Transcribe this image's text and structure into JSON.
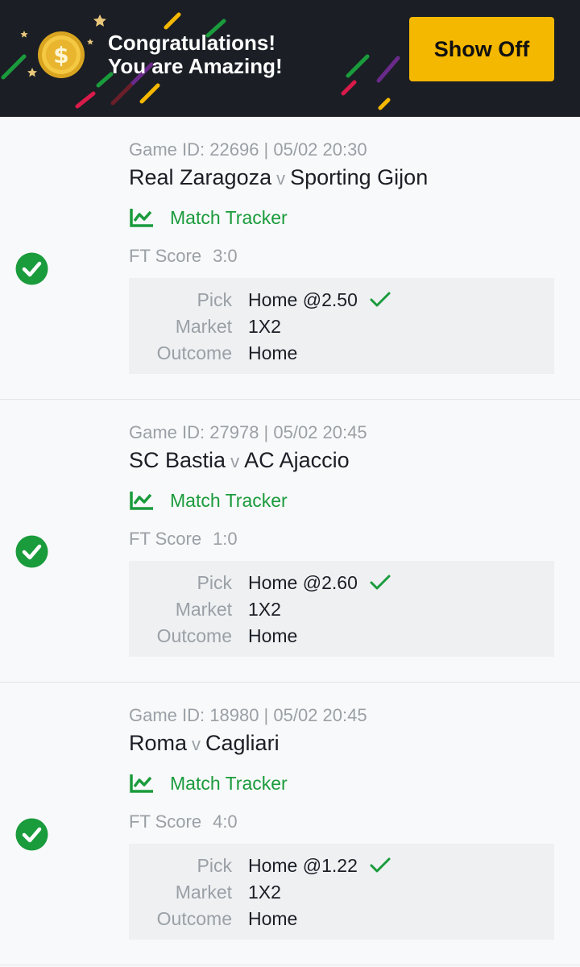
{
  "banner": {
    "line1": "Congratulations!",
    "line2": "You are Amazing!",
    "show_off_label": "Show Off",
    "coin_icon": "dollar-coin-icon",
    "colors": {
      "background": "#1b1e25",
      "button": "#f5b800"
    }
  },
  "colors": {
    "win_green": "#1a9b3c",
    "muted": "#9aa0a6",
    "text": "#1b1e25"
  },
  "bets": [
    {
      "game_meta": "Game ID: 22696 | 05/02 20:30",
      "home": "Real Zaragoza",
      "vs": "v",
      "away": "Sporting Gijon",
      "tracker_label": "Match Tracker",
      "ft_label": "FT Score",
      "ft_score": "3:0",
      "pick_label": "Pick",
      "pick": "Home @2.50",
      "market_label": "Market",
      "market": "1X2",
      "outcome_label": "Outcome",
      "outcome": "Home"
    },
    {
      "game_meta": "Game ID: 27978 | 05/02 20:45",
      "home": "SC Bastia",
      "vs": "v",
      "away": "AC Ajaccio",
      "tracker_label": "Match Tracker",
      "ft_label": "FT Score",
      "ft_score": "1:0",
      "pick_label": "Pick",
      "pick": "Home @2.60",
      "market_label": "Market",
      "market": "1X2",
      "outcome_label": "Outcome",
      "outcome": "Home"
    },
    {
      "game_meta": "Game ID: 18980 | 05/02 20:45",
      "home": "Roma",
      "vs": "v",
      "away": "Cagliari",
      "tracker_label": "Match Tracker",
      "ft_label": "FT Score",
      "ft_score": "4:0",
      "pick_label": "Pick",
      "pick": "Home @1.22",
      "market_label": "Market",
      "market": "1X2",
      "outcome_label": "Outcome",
      "outcome": "Home"
    }
  ]
}
